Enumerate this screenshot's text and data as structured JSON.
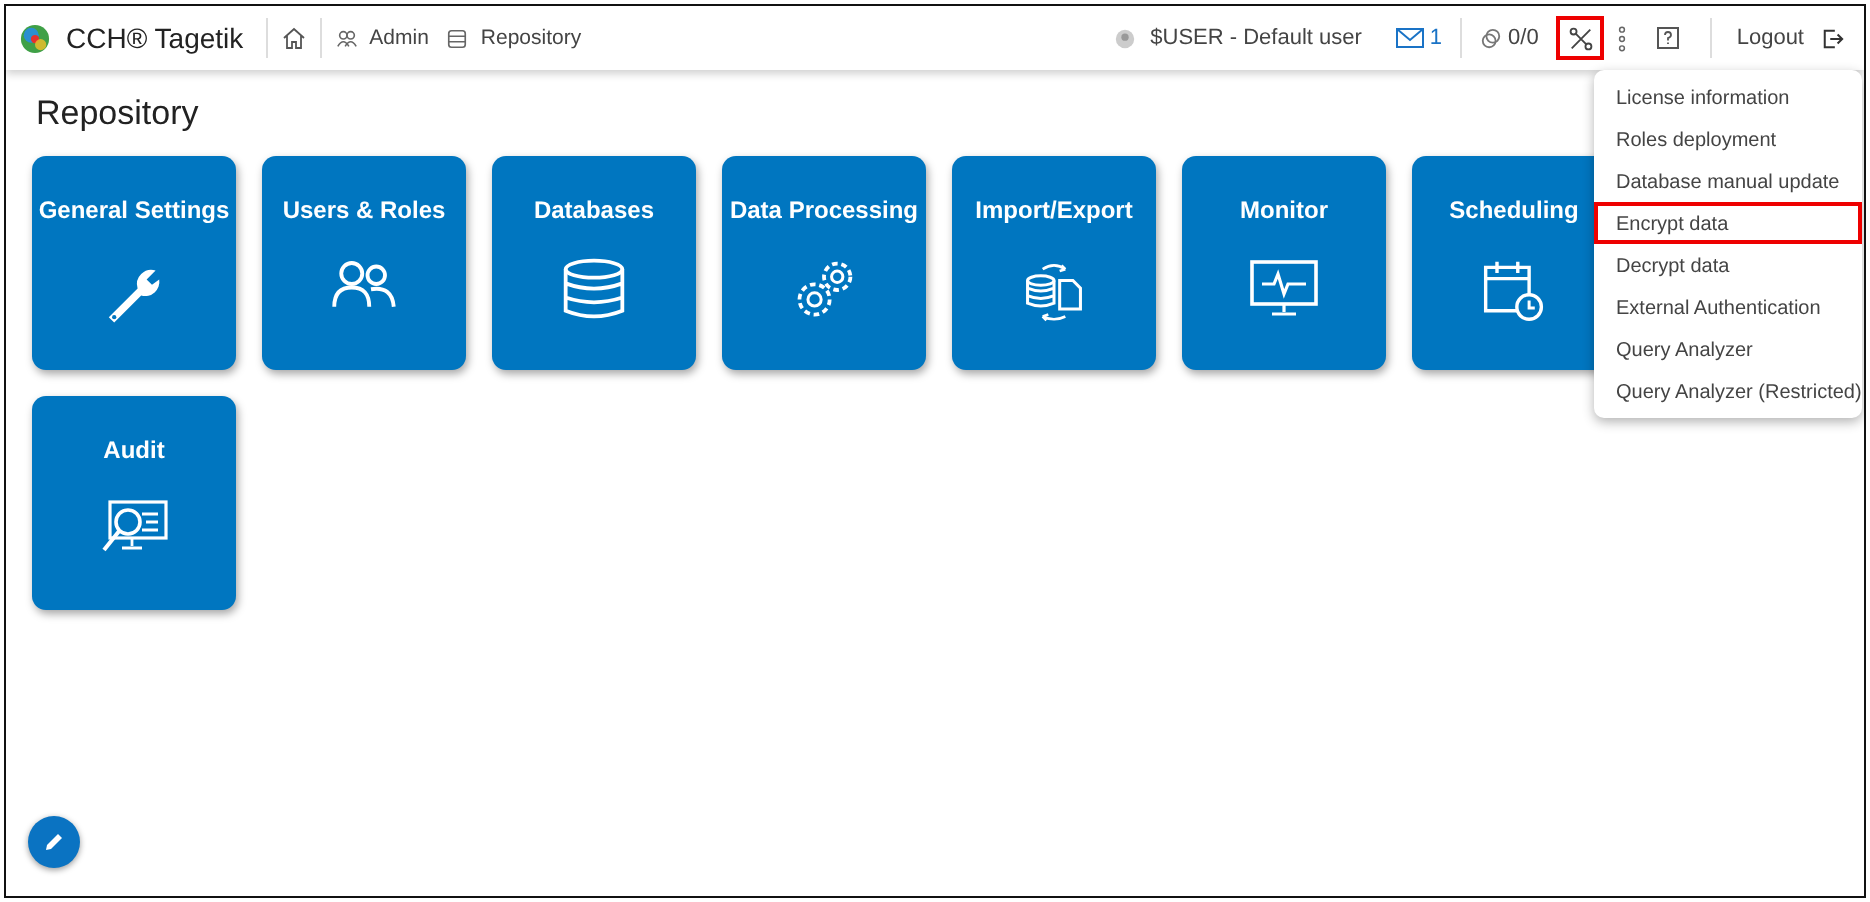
{
  "header": {
    "brand": "CCH® Tagetik",
    "breadcrumbs": [
      {
        "label": "Admin",
        "kind": "users"
      },
      {
        "label": "Repository",
        "kind": "database"
      }
    ],
    "user": "$USER - Default user",
    "messages": "1",
    "tasks": "0/0",
    "tools_highlighted": true,
    "logout": "Logout"
  },
  "page": {
    "title": "Repository"
  },
  "tiles": [
    {
      "label": "General Settings",
      "kind": "settings"
    },
    {
      "label": "Users & Roles",
      "kind": "users"
    },
    {
      "label": "Databases",
      "kind": "databases"
    },
    {
      "label": "Data Processing",
      "kind": "processing"
    },
    {
      "label": "Import/Export",
      "kind": "transfer"
    },
    {
      "label": "Monitor",
      "kind": "monitor"
    },
    {
      "label": "Scheduling",
      "kind": "scheduling"
    },
    {
      "label": "Audit",
      "kind": "audit"
    }
  ],
  "tools_menu": {
    "items": [
      {
        "label": "License information",
        "highlighted": false
      },
      {
        "label": "Roles deployment",
        "highlighted": false
      },
      {
        "label": "Database manual update",
        "highlighted": false
      },
      {
        "label": "Encrypt data",
        "highlighted": true
      },
      {
        "label": "Decrypt data",
        "highlighted": false
      },
      {
        "label": "External Authentication",
        "highlighted": false
      },
      {
        "label": "Query Analyzer",
        "highlighted": false
      },
      {
        "label": "Query Analyzer (Restricted)",
        "highlighted": false
      }
    ]
  }
}
